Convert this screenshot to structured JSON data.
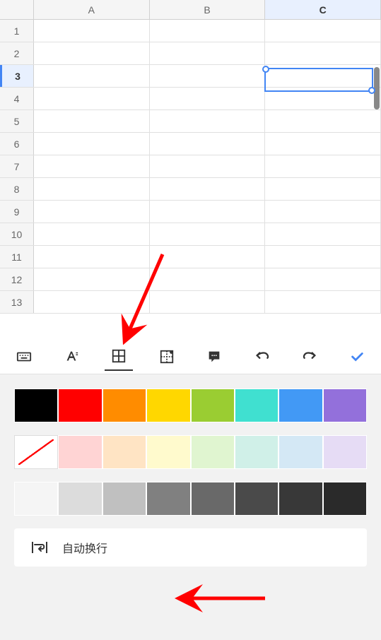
{
  "grid": {
    "columns": [
      "A",
      "B",
      "C"
    ],
    "rows": [
      1,
      2,
      3,
      4,
      5,
      6,
      7,
      8,
      9,
      10,
      11,
      12,
      13
    ],
    "selectedCell": "C3",
    "selectedRow": 3,
    "selectedCol": "C"
  },
  "toolbar": {
    "icons": [
      "keyboard",
      "text-format",
      "borders",
      "insert-cell",
      "comment",
      "undo",
      "redo",
      "done"
    ]
  },
  "panel": {
    "colorsSolid": [
      "#000000",
      "#ff0000",
      "#ff8c00",
      "#ffd700",
      "#9acd32",
      "#40e0d0",
      "#4299f5",
      "#9370db"
    ],
    "colorsLight": [
      "nofill",
      "#ffd4d4",
      "#ffe4c4",
      "#fffacd",
      "#e0f5d0",
      "#d0f0e8",
      "#d4e8f5",
      "#e6dcf5"
    ],
    "colorsGray": [
      "#f5f5f5",
      "#dcdcdc",
      "#c0c0c0",
      "#808080",
      "#696969",
      "#4a4a4a",
      "#383838",
      "#2a2a2a"
    ],
    "wrapLabel": "自动换行"
  }
}
